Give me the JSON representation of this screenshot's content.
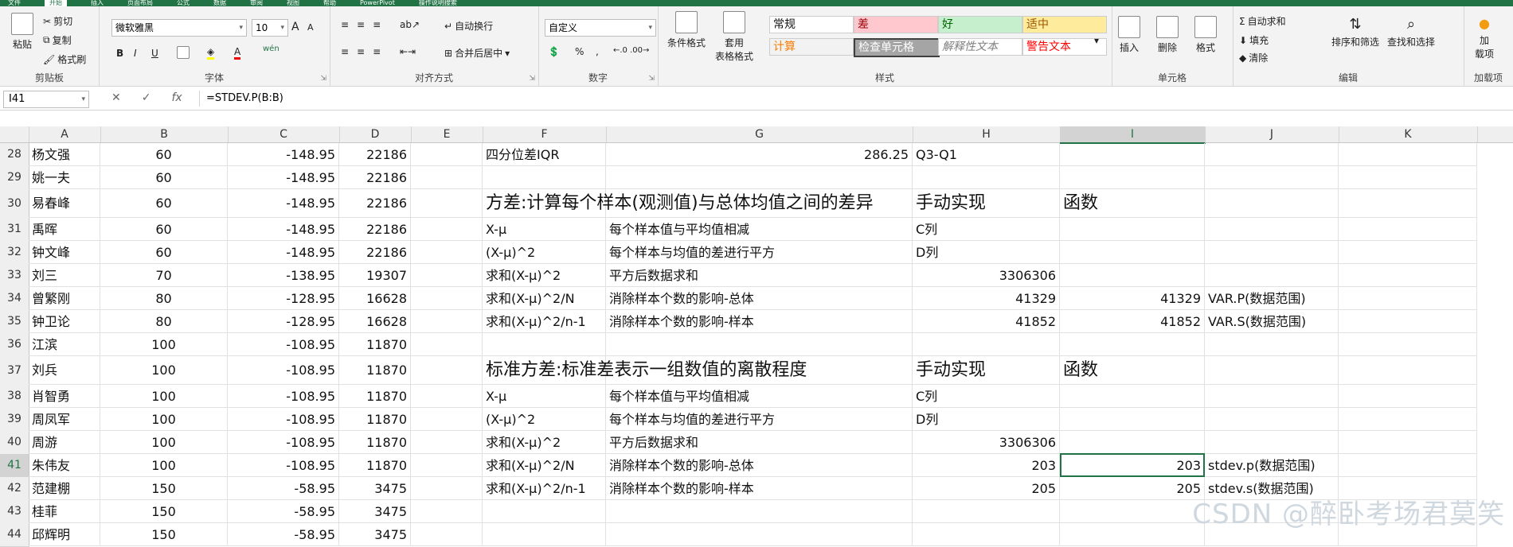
{
  "ribbon": {
    "tabs": [
      "文件",
      "开始",
      "插入",
      "页面布局",
      "公式",
      "数据",
      "审阅",
      "视图",
      "帮助",
      "PowerPivot",
      "操作说明搜索"
    ],
    "clipboard": {
      "label": "剪贴板",
      "paste": "粘贴",
      "cut": "剪切",
      "copy": "复制",
      "format_painter": "格式刷"
    },
    "font": {
      "label": "字体",
      "name": "微软雅黑",
      "size": "10",
      "bold": "B",
      "italic": "I",
      "underline": "U",
      "grow": "A",
      "shrink": "A",
      "wen": "wén",
      "color_letter": "A"
    },
    "alignment": {
      "label": "对齐方式",
      "wrap": "自动换行",
      "merge": "合并后居中"
    },
    "number": {
      "label": "数字",
      "format": "自定义",
      "percent": "%"
    },
    "styles": {
      "label": "样式",
      "conditional": "条件格式",
      "table": "套用\n表格格式",
      "cells": [
        {
          "text": "常规",
          "bg": "#ffffff",
          "fg": "#111111"
        },
        {
          "text": "差",
          "bg": "#ffc7ce",
          "fg": "#9c0006"
        },
        {
          "text": "好",
          "bg": "#c6efce",
          "fg": "#006100"
        },
        {
          "text": "适中",
          "bg": "#ffeb9c",
          "fg": "#9c5700"
        },
        {
          "text": "计算",
          "bg": "#f2f2f2",
          "fg": "#fa7d00"
        },
        {
          "text": "检查单元格",
          "bg": "#a5a5a5",
          "fg": "#ffffff"
        },
        {
          "text": "解释性文本",
          "bg": "#ffffff",
          "fg": "#7f7f7f"
        },
        {
          "text": "警告文本",
          "bg": "#ffffff",
          "fg": "#ff0000"
        }
      ]
    },
    "cells_group": {
      "label": "单元格",
      "insert": "插入",
      "delete": "删除",
      "format": "格式"
    },
    "editing": {
      "label": "编辑",
      "autosum": "自动求和",
      "fill": "填充",
      "clear": "清除",
      "sort": "排序和筛选",
      "find": "查找和选择"
    },
    "addins": {
      "label": "加载项",
      "addin": "加\n载项"
    }
  },
  "formula_bar": {
    "name_box": "I41",
    "cancel": "✕",
    "enter": "✓",
    "fx": "fx",
    "formula": "=STDEV.P(B:B)"
  },
  "columns": [
    "A",
    "B",
    "C",
    "D",
    "E",
    "F",
    "G",
    "H",
    "I",
    "J",
    "K"
  ],
  "rows": [
    {
      "n": "28",
      "A": "杨文强",
      "B": "60",
      "C": "-148.95",
      "D": "22186",
      "F": "四分位差IQR",
      "G": "286.25",
      "H": "Q3-Q1"
    },
    {
      "n": "29",
      "A": "姚一夫",
      "B": "60",
      "C": "-148.95",
      "D": "22186"
    },
    {
      "n": "30",
      "A": "易春峰",
      "B": "60",
      "C": "-148.95",
      "D": "22186",
      "F": "方差:计算每个样本(观测值)与总体均值之间的差异",
      "H": "手动实现",
      "I": "函数",
      "big": true
    },
    {
      "n": "31",
      "A": "禹晖",
      "B": "60",
      "C": "-148.95",
      "D": "22186",
      "F": "X-μ",
      "G": "每个样本值与平均值相减",
      "H": "C列"
    },
    {
      "n": "32",
      "A": "钟文峰",
      "B": "60",
      "C": "-148.95",
      "D": "22186",
      "F": "(X-μ)^2",
      "G": "每个样本与均值的差进行平方",
      "H": "D列"
    },
    {
      "n": "33",
      "A": "刘三",
      "B": "70",
      "C": "-138.95",
      "D": "19307",
      "F": "求和(X-μ)^2",
      "G": "平方后数据求和",
      "Hn": "3306306"
    },
    {
      "n": "34",
      "A": "曾繁刚",
      "B": "80",
      "C": "-128.95",
      "D": "16628",
      "F": "求和(X-μ)^2/N",
      "G": "消除样本个数的影响-总体",
      "Hn": "41329",
      "I": "41329",
      "J": "VAR.P(数据范围)"
    },
    {
      "n": "35",
      "A": "钟卫论",
      "B": "80",
      "C": "-128.95",
      "D": "16628",
      "F": "求和(X-μ)^2/n-1",
      "G": "消除样本个数的影响-样本",
      "Hn": "41852",
      "I": "41852",
      "J": "VAR.S(数据范围)"
    },
    {
      "n": "36",
      "A": "江滨",
      "B": "100",
      "C": "-108.95",
      "D": "11870"
    },
    {
      "n": "37",
      "A": "刘兵",
      "B": "100",
      "C": "-108.95",
      "D": "11870",
      "F": "标准方差:标准差表示一组数值的离散程度",
      "H": "手动实现",
      "I": "函数",
      "big": true
    },
    {
      "n": "38",
      "A": "肖智勇",
      "B": "100",
      "C": "-108.95",
      "D": "11870",
      "F": "X-μ",
      "G": "每个样本值与平均值相减",
      "H": "C列"
    },
    {
      "n": "39",
      "A": "周凤军",
      "B": "100",
      "C": "-108.95",
      "D": "11870",
      "F": "(X-μ)^2",
      "G": "每个样本与均值的差进行平方",
      "H": "D列"
    },
    {
      "n": "40",
      "A": "周游",
      "B": "100",
      "C": "-108.95",
      "D": "11870",
      "F": "求和(X-μ)^2",
      "G": "平方后数据求和",
      "Hn": "3306306"
    },
    {
      "n": "41",
      "A": "朱伟友",
      "B": "100",
      "C": "-108.95",
      "D": "11870",
      "F": "求和(X-μ)^2/N",
      "G": "消除样本个数的影响-总体",
      "Hn": "203",
      "I": "203",
      "J": "stdev.p(数据范围)"
    },
    {
      "n": "42",
      "A": "范建棚",
      "B": "150",
      "C": "-58.95",
      "D": "3475",
      "F": "求和(X-μ)^2/n-1",
      "G": "消除样本个数的影响-样本",
      "Hn": "205",
      "I": "205",
      "J": "stdev.s(数据范围)"
    },
    {
      "n": "43",
      "A": "桂菲",
      "B": "150",
      "C": "-58.95",
      "D": "3475"
    },
    {
      "n": "44",
      "A": "邱辉明",
      "B": "150",
      "C": "-58.95",
      "D": "3475"
    }
  ],
  "watermark": "CSDN @醉卧考场君莫笑"
}
